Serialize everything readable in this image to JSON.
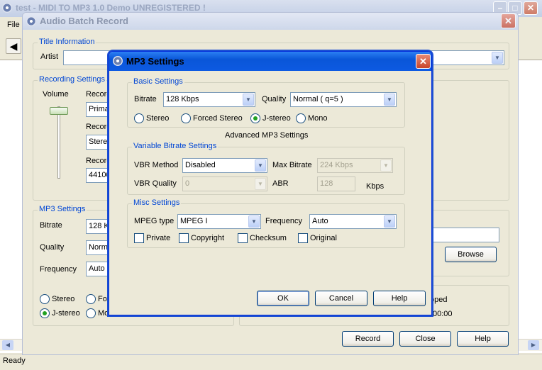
{
  "app": {
    "title": "test - MIDI TO MP3 1.0 Demo UNREGISTERED !",
    "menu_file": "File",
    "status": "Ready"
  },
  "batch": {
    "title": "Audio Batch Record",
    "title_info": {
      "group_label": "Title Information",
      "artist_label": "Artist",
      "artist_value": ""
    },
    "recording": {
      "group_label": "Recording Settings",
      "volume_label": "Volume",
      "record_label_1": "Record",
      "record_value_1": "Primary",
      "record_label_2": "Record",
      "record_value_2": "Stereo",
      "record_label_3": "Record",
      "record_value_3": "44100"
    },
    "mp3": {
      "group_label": "MP3 Settings",
      "bitrate_label": "Bitrate",
      "bitrate_value": "128 K",
      "quality_label": "Quality",
      "quality_value": "Norma",
      "frequency_label": "Frequency",
      "frequency_value": "Auto",
      "stereo": "Stereo",
      "forced": "For",
      "jstereo": "J-stereo",
      "mono": "Mo"
    },
    "output": {
      "browse": "Browse"
    },
    "status": {
      "state": "pped",
      "time": "00:00"
    },
    "buttons": {
      "record": "Record",
      "close": "Close",
      "help": "Help"
    }
  },
  "dialog": {
    "title": "MP3 Settings",
    "basic": {
      "group_label": "Basic Settings",
      "bitrate_label": "Bitrate",
      "bitrate_value": "128 Kbps",
      "quality_label": "Quality",
      "quality_value": "Normal ( q=5 )",
      "stereo": "Stereo",
      "forced_stereo": "Forced Stereo",
      "jstereo": "J-stereo",
      "mono": "Mono",
      "selected_mode": "J-stereo"
    },
    "advanced_label": "Advanced MP3 Settings",
    "vbr": {
      "group_label": "Variable Bitrate Settings",
      "method_label": "VBR Method",
      "method_value": "Disabled",
      "max_bitrate_label": "Max Bitrate",
      "max_bitrate_value": "224 Kbps",
      "quality_label": "VBR Quality",
      "quality_value": "0",
      "abr_label": "ABR",
      "abr_value": "128",
      "abr_unit": "Kbps"
    },
    "misc": {
      "group_label": "Misc Settings",
      "mpeg_type_label": "MPEG type",
      "mpeg_type_value": "MPEG I",
      "frequency_label": "Frequency",
      "frequency_value": "Auto",
      "private": "Private",
      "copyright": "Copyright",
      "checksum": "Checksum",
      "original": "Original"
    },
    "buttons": {
      "ok": "OK",
      "cancel": "Cancel",
      "help": "Help"
    }
  },
  "colors": {
    "group_label": "#0046d5",
    "title_bar": "#0a56d8",
    "close_button": "#c9452a"
  }
}
